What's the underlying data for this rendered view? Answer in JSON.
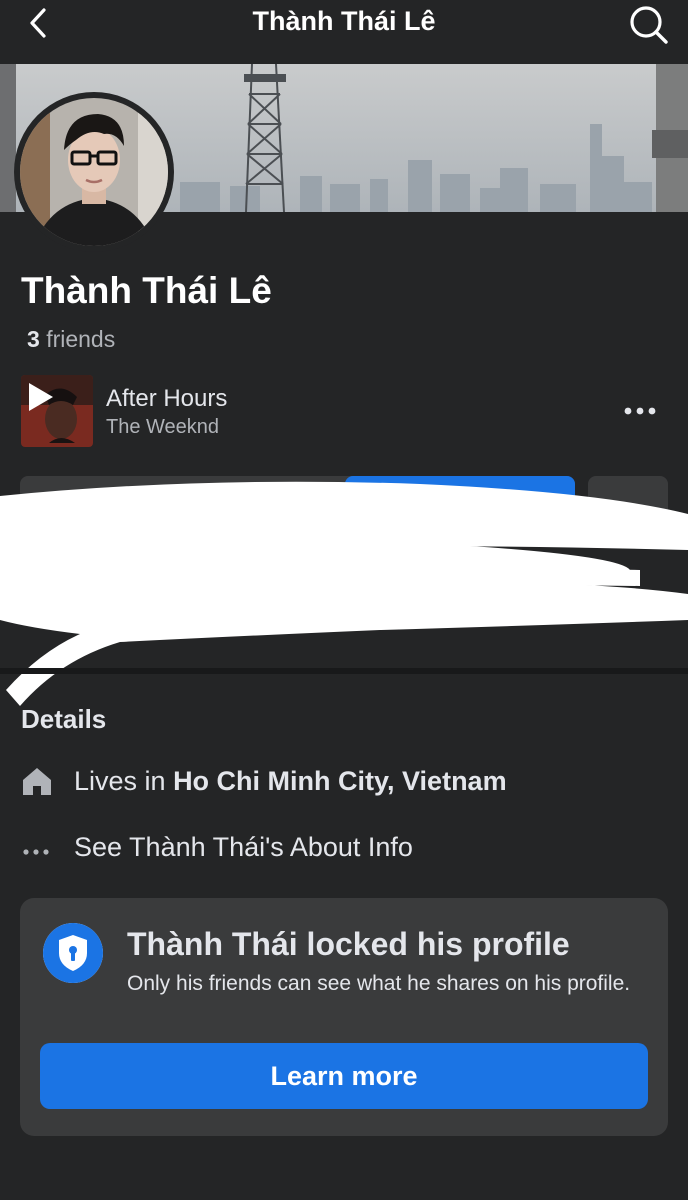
{
  "header": {
    "title": "Thành Thái Lê"
  },
  "profile": {
    "name": "Thành Thái Lê",
    "friends_count": "3",
    "friends_label": "friends"
  },
  "music": {
    "song": "After Hours",
    "artist": "The Weeknd"
  },
  "details": {
    "heading": "Details",
    "lives_in_prefix": "Lives in",
    "lives_in_place": "Ho Chi Minh City, Vietnam",
    "about_link": "See Thành Thái's About Info"
  },
  "lock_notice": {
    "title": "Thành Thái locked his profile",
    "description": "Only his friends can see what he shares on his profile.",
    "button": "Learn more"
  },
  "colors": {
    "background": "#242526",
    "card": "#3a3b3c",
    "accent": "#1b74e4",
    "text_primary": "#e4e6eb",
    "text_secondary": "#b0b3b8"
  },
  "icons": {
    "back": "chevron-left-icon",
    "search": "search-icon",
    "more": "more-horizontal-icon",
    "home": "home-icon",
    "dots": "ellipsis-icon",
    "shield": "shield-lock-icon",
    "play": "play-icon"
  }
}
